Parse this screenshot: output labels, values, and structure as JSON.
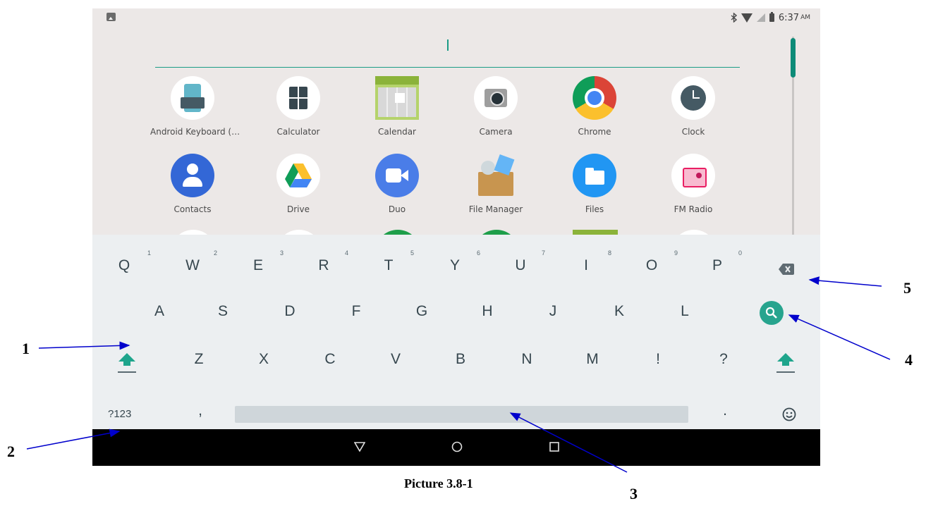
{
  "status_bar": {
    "time": "6:37",
    "ampm": "AM",
    "icons": [
      "image-icon",
      "bluetooth-icon",
      "wifi-icon",
      "no-sim-icon",
      "battery-icon"
    ]
  },
  "apps_row1": [
    {
      "label": "Android Keyboard (…",
      "icon": "keyboard-app-icon"
    },
    {
      "label": "Calculator",
      "icon": "calculator-icon"
    },
    {
      "label": "Calendar",
      "icon": "calendar-icon"
    },
    {
      "label": "Camera",
      "icon": "camera-icon"
    },
    {
      "label": "Chrome",
      "icon": "chrome-icon"
    },
    {
      "label": "Clock",
      "icon": "clock-icon"
    }
  ],
  "apps_row2": [
    {
      "label": "Contacts",
      "icon": "contacts-icon"
    },
    {
      "label": "Drive",
      "icon": "drive-icon"
    },
    {
      "label": "Duo",
      "icon": "duo-icon"
    },
    {
      "label": "File Manager",
      "icon": "file-manager-icon"
    },
    {
      "label": "Files",
      "icon": "files-icon"
    },
    {
      "label": "FM Radio",
      "icon": "fm-radio-icon"
    }
  ],
  "keyboard": {
    "row1": [
      "Q",
      "W",
      "E",
      "R",
      "T",
      "Y",
      "U",
      "I",
      "O",
      "P"
    ],
    "row1_hints": [
      "1",
      "2",
      "3",
      "4",
      "5",
      "6",
      "7",
      "8",
      "9",
      "0"
    ],
    "row2": [
      "A",
      "S",
      "D",
      "F",
      "G",
      "H",
      "J",
      "K",
      "L"
    ],
    "row3": [
      "Z",
      "X",
      "C",
      "V",
      "B",
      "N",
      "M",
      "!",
      "?"
    ],
    "symbols_key": "?123",
    "comma": ",",
    "period": ".",
    "special_keys": [
      "backspace-icon",
      "search-icon",
      "shift-icon",
      "emoji-icon"
    ]
  },
  "colors": {
    "accent": "#1a9c86",
    "drawer_bg": "#ece8e7",
    "keyboard_bg": "#eceff1",
    "navbar_bg": "#000000",
    "annotation_arrow": "#0000cc"
  },
  "annotations": [
    "1",
    "2",
    "3",
    "4",
    "5"
  ],
  "caption": "Picture 3.8-1"
}
